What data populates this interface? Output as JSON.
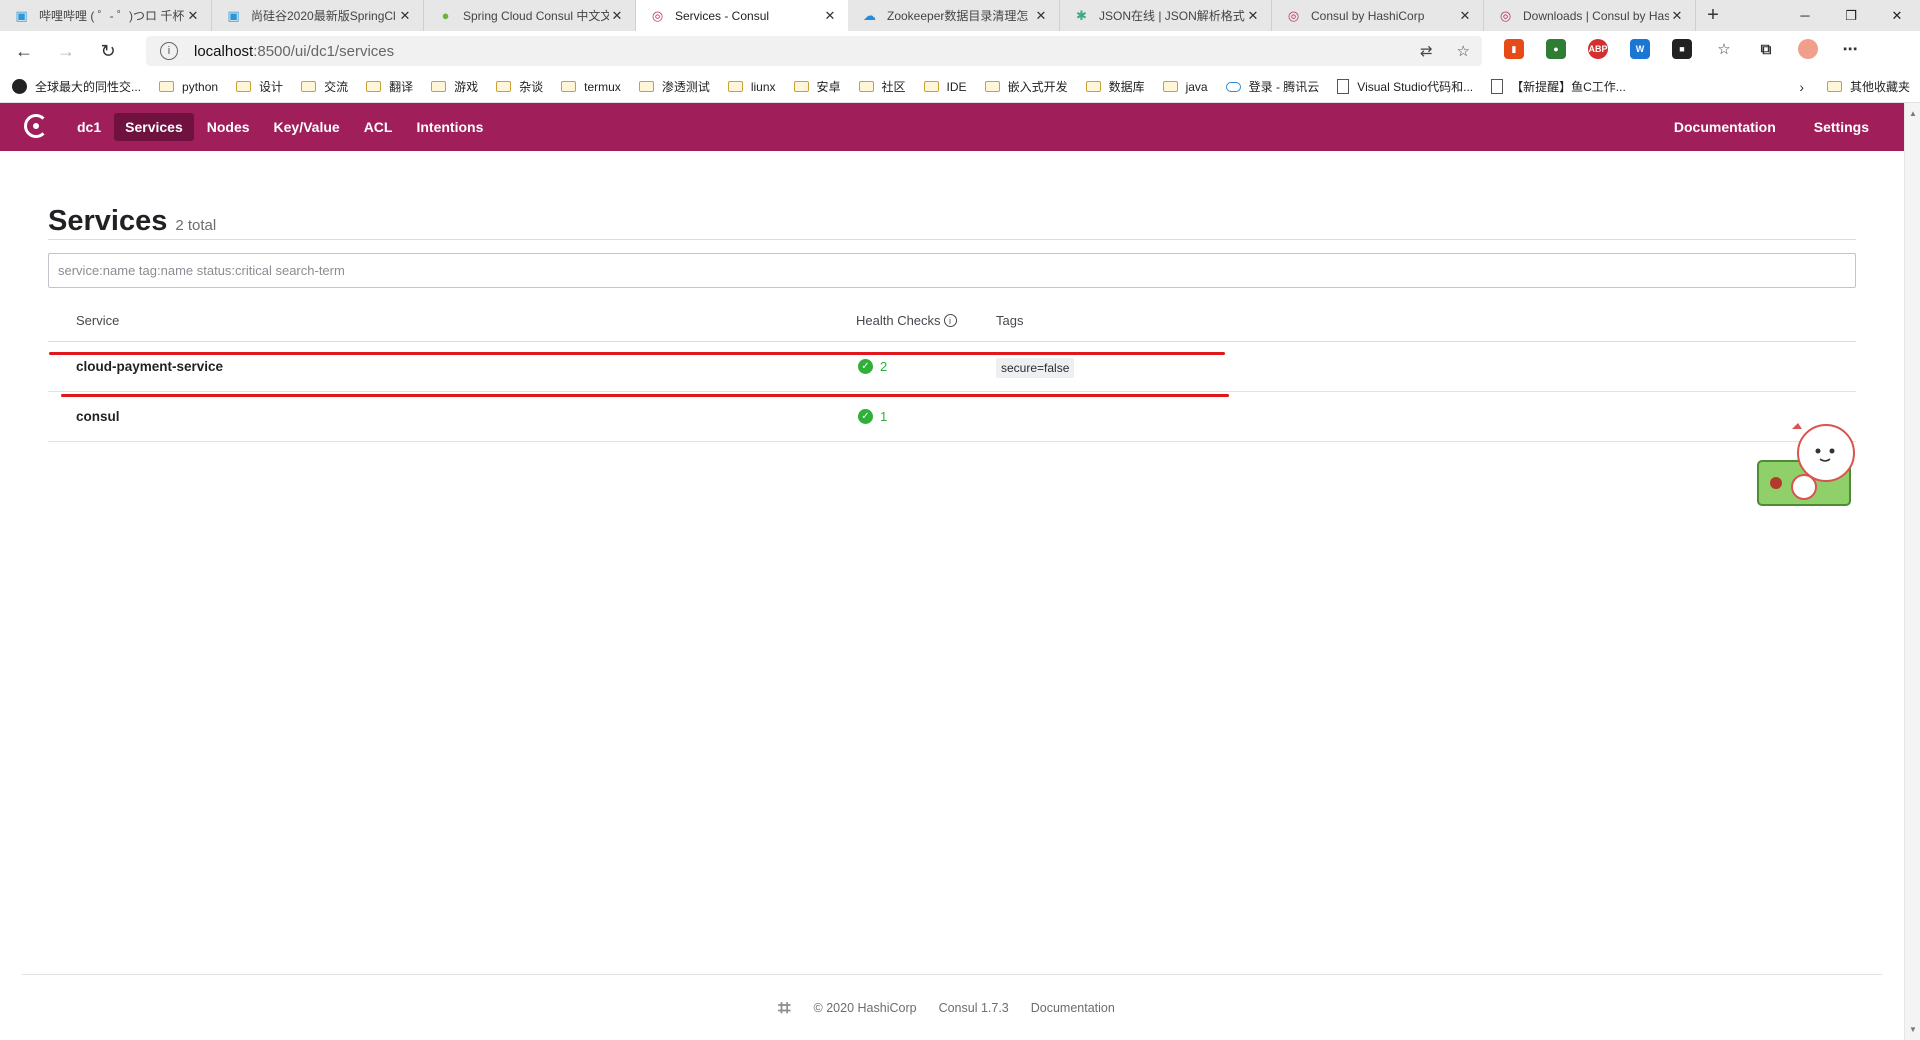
{
  "browser": {
    "tabs": [
      {
        "title": "哔哩哔哩 ( ゜- ゜)つロ 千杯",
        "icon": "bilibili-icon",
        "active": false
      },
      {
        "title": "尚硅谷2020最新版SpringCl",
        "icon": "bilibili-icon",
        "active": false
      },
      {
        "title": "Spring Cloud Consul 中文文",
        "icon": "spring-icon",
        "active": false
      },
      {
        "title": "Services - Consul",
        "icon": "consul-icon",
        "active": true
      },
      {
        "title": "Zookeeper数据目录清理怎",
        "icon": "cloud-icon",
        "active": false
      },
      {
        "title": "JSON在线 | JSON解析格式化",
        "icon": "json-icon",
        "active": false
      },
      {
        "title": "Consul by HashiCorp",
        "icon": "consul-icon",
        "active": false
      },
      {
        "title": "Downloads | Consul by Has",
        "icon": "consul-icon",
        "active": false
      }
    ],
    "url_host": "localhost",
    "url_path": ":8500/ui/dc1/services",
    "bookmarks": [
      {
        "label": "全球最大的同性交...",
        "icon": "github-icon"
      },
      {
        "label": "python",
        "icon": "folder-icon"
      },
      {
        "label": "设计",
        "icon": "folder-icon"
      },
      {
        "label": "交流",
        "icon": "folder-icon"
      },
      {
        "label": "翻译",
        "icon": "folder-icon"
      },
      {
        "label": "游戏",
        "icon": "folder-icon"
      },
      {
        "label": "杂谈",
        "icon": "folder-icon"
      },
      {
        "label": "termux",
        "icon": "folder-icon"
      },
      {
        "label": "渗透测试",
        "icon": "folder-icon"
      },
      {
        "label": "liunx",
        "icon": "folder-icon"
      },
      {
        "label": "安卓",
        "icon": "folder-icon"
      },
      {
        "label": "社区",
        "icon": "folder-icon"
      },
      {
        "label": "IDE",
        "icon": "folder-icon"
      },
      {
        "label": "嵌入式开发",
        "icon": "folder-icon"
      },
      {
        "label": "数据库",
        "icon": "folder-icon"
      },
      {
        "label": "java",
        "icon": "folder-icon"
      },
      {
        "label": "登录 - 腾讯云",
        "icon": "cloud-icon"
      },
      {
        "label": "Visual Studio代码和...",
        "icon": "page-icon"
      },
      {
        "label": "【新提醒】鱼C工作...",
        "icon": "page-icon"
      }
    ],
    "other_bookmarks": "其他收藏夹"
  },
  "nav": {
    "dc": "dc1",
    "items": [
      "Services",
      "Nodes",
      "Key/Value",
      "ACL",
      "Intentions"
    ],
    "active": "Services",
    "right": [
      "Documentation",
      "Settings"
    ],
    "brand_color": "#a01f5a"
  },
  "page": {
    "title": "Services",
    "count": "2 total",
    "search_placeholder": "service:name tag:name status:critical search-term"
  },
  "table": {
    "headers": {
      "service": "Service",
      "health": "Health Checks",
      "tags": "Tags"
    },
    "rows": [
      {
        "service": "cloud-payment-service",
        "checks": "2",
        "tag": "secure=false",
        "highlighted": true
      },
      {
        "service": "consul",
        "checks": "1",
        "tag": "",
        "highlighted": false
      }
    ]
  },
  "footer": {
    "copyright": "© 2020 HashiCorp",
    "version": "Consul 1.7.3",
    "docs": "Documentation"
  }
}
